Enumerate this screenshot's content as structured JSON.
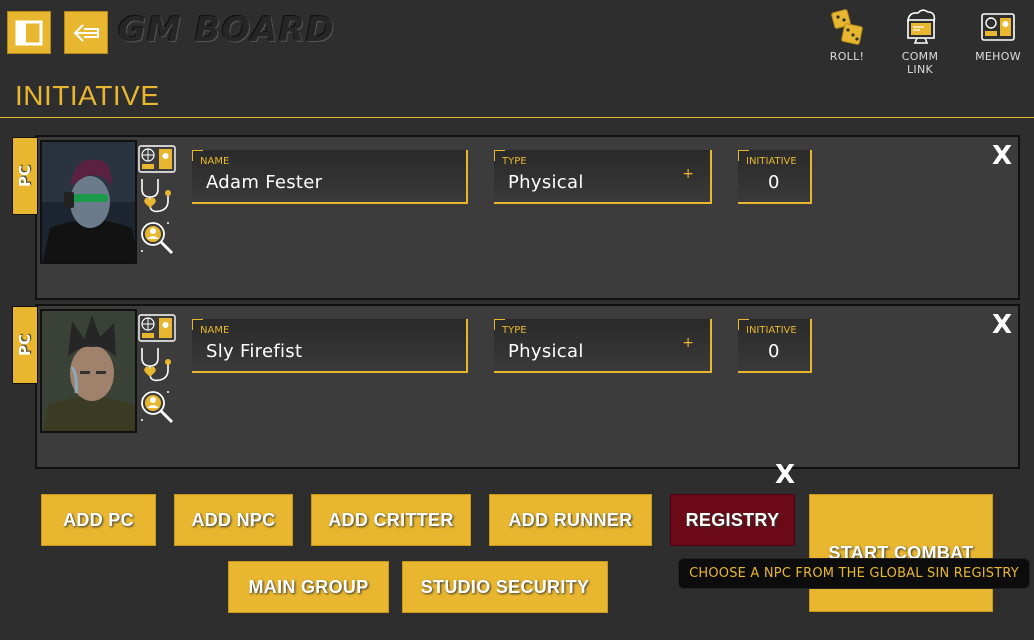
{
  "header": {
    "logo": "GM BOARD",
    "actions": [
      {
        "label": "ROLL!",
        "icon": "dice-icon"
      },
      {
        "label": "COMM LINK",
        "icon": "comm-link-icon"
      },
      {
        "label": "MEHOW",
        "icon": "id-card-icon"
      }
    ]
  },
  "page_title": "INITIATIVE",
  "rows": [
    {
      "tab": "PC",
      "name_label": "NAME",
      "name": "Adam Fester",
      "type_label": "TYPE",
      "type": "Physical",
      "type_plus": "+",
      "init_label": "INITIATIVE",
      "initiative": "0",
      "close": "X"
    },
    {
      "tab": "PC",
      "name_label": "NAME",
      "name": "Sly Firefist",
      "type_label": "TYPE",
      "type": "Physical",
      "type_plus": "+",
      "init_label": "INITIATIVE",
      "initiative": "0",
      "close": "X"
    }
  ],
  "buttons": {
    "add_pc": "ADD PC",
    "add_npc": "ADD NPC",
    "add_critter": "ADD CRITTER",
    "add_runner": "ADD RUNNER",
    "registry": "REGISTRY",
    "start_combat": "START COMBAT",
    "main_group": "MAIN GROUP",
    "studio_security": "STUDIO SECURITY"
  },
  "floating_close": "X",
  "tooltip": "CHOOSE A NPC FROM THE GLOBAL SIN REGISTRY",
  "colors": {
    "accent": "#e8b72f",
    "background": "#2e2e2e",
    "panel": "#3c3c3c",
    "registry": "#6b0a16"
  }
}
